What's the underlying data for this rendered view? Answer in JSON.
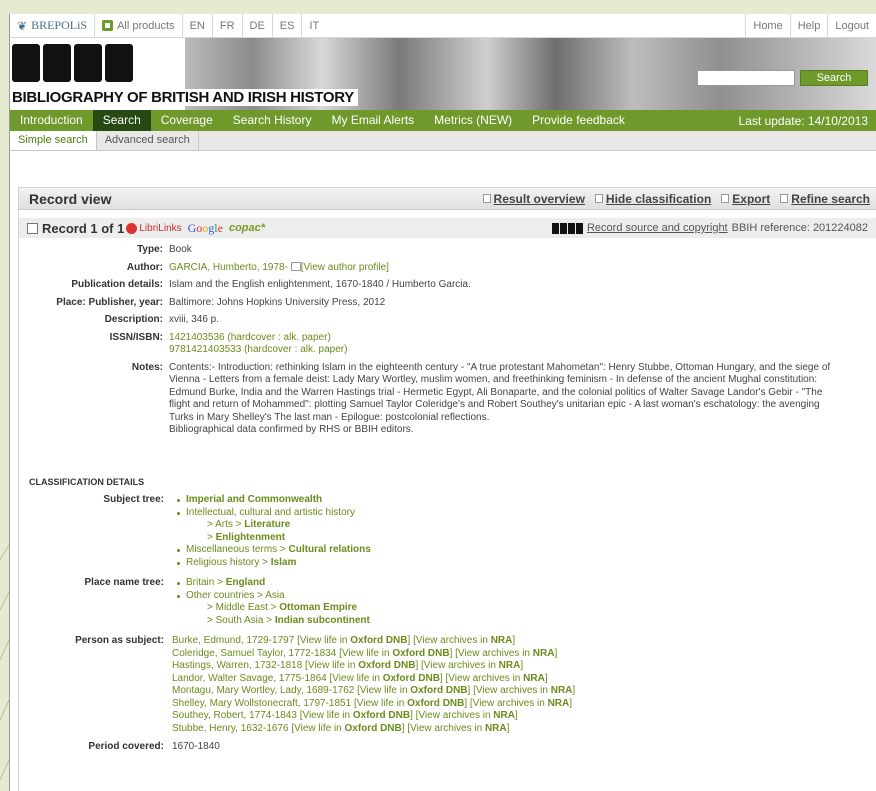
{
  "topbar": {
    "brand": "BREPOLiS",
    "all_products": "All products",
    "langs": [
      "EN",
      "FR",
      "DE",
      "ES",
      "IT"
    ],
    "home": "Home",
    "help": "Help",
    "logout": "Logout"
  },
  "banner": {
    "title": "BIBLIOGRAPHY OF BRITISH AND IRISH HISTORY",
    "search_value": "",
    "search_button": "Search"
  },
  "nav": {
    "items": [
      "Introduction",
      "Search",
      "Coverage",
      "Search History",
      "My Email Alerts",
      "Metrics (NEW)",
      "Provide feedback"
    ],
    "active": "Search",
    "last_update": "Last update: 14/10/2013"
  },
  "subnav": {
    "simple": "Simple search",
    "advanced": "Advanced search"
  },
  "panel": {
    "title": "Record view",
    "links": [
      "Result overview",
      "Hide classification",
      "Export",
      "Refine search"
    ]
  },
  "record": {
    "label": "Record 1 of 1",
    "librilinks": "LibriLinks",
    "google": "Google",
    "copac": "copac*",
    "source": "Record source and copyright",
    "reference": "BBIH reference: 201224082",
    "type_label": "Type:",
    "type": "Book",
    "author_label": "Author:",
    "author": "GARCIA, Humberto, 1978-",
    "author_profile": "[View author profile]",
    "pub_label": "Publication details:",
    "pub": "Islam and the English enlightenment, 1670-1840 / Humberto Garcia.",
    "place_label": "Place: Publisher, year:",
    "place": "Baltimore: Johns Hopkins University Press, 2012",
    "desc_label": "Description:",
    "desc": "xviii, 346 p.",
    "isbn_label": "ISSN/ISBN:",
    "isbn1": "1421403536 (hardcover : alk. paper)",
    "isbn2": "9781421403533 (hardcover : alk. paper)",
    "notes_label": "Notes:",
    "notes1": "Contents:- Introduction: rethinking Islam in the eighteenth century - \"A true protestant Mahometan\": Henry Stubbe, Ottoman Hungary, and the siege of",
    "notes2": "Vienna - Letters from a female deist: Lady Mary Wortley, muslim women, and freethinking feminism - In defense of the ancient Mughal constitution:",
    "notes3": "Edmund Burke, India and the Warren Hastings trial - Hermetic Egypt, Ali Bonaparte, and the colonial politics of Walter Savage Landor's Gebir - \"The",
    "notes4": "flight and return of Mohammed\": plotting Samuel Taylor Coleridge's and Robert Southey's unitarian epic - A last woman's eschatology: the avenging",
    "notes5": "Turks in Mary Shelley's The last man - Epilogue: postcolonial reflections.",
    "notes6": "Bibliographical data confirmed by RHS or BBIH editors."
  },
  "classification": {
    "heading": "CLASSIFICATION DETAILS",
    "subject_label": "Subject tree:",
    "s1": "Imperial and Commonwealth",
    "s2": "Intellectual, cultural and artistic history",
    "s3a": "> Arts > ",
    "s3b": "Literature",
    "s4a": "> ",
    "s4b": "Enlightenment",
    "s5a": "Miscellaneous terms > ",
    "s5b": "Cultural relations",
    "s6a": "Religious history > ",
    "s6b": "Islam",
    "place_label": "Place name tree:",
    "p1a": "Britain > ",
    "p1b": "England",
    "p2": "Other countries > Asia",
    "p3a": "> Middle East > ",
    "p3b": "Ottoman Empire",
    "p4a": "> South Asia > ",
    "p4b": "Indian subcontinent",
    "person_label": "Person as subject:",
    "persons": [
      "Burke, Edmund, 1729-1797",
      "Coleridge, Samuel Taylor, 1772-1834",
      "Hastings, Warren, 1732-1818",
      "Landor, Walter Savage, 1775-1864",
      "Montagu, Mary Wortley, Lady, 1689-1762",
      "Shelley, Mary Wollstonecraft, 1797-1851",
      "Southey, Robert, 1774-1843",
      "Stubbe, Henry, 1632-1676"
    ],
    "view_life": "[View life in ",
    "oxford": "Oxford DNB",
    "close": "]",
    "view_archives": " [View archives in ",
    "nra": "NRA",
    "period_label": "Period covered:",
    "period": "1670-1840"
  },
  "colors": {
    "accent": "#6f9a2b",
    "active_nav": "#264a12",
    "page_bg": "#e5ebd0"
  }
}
